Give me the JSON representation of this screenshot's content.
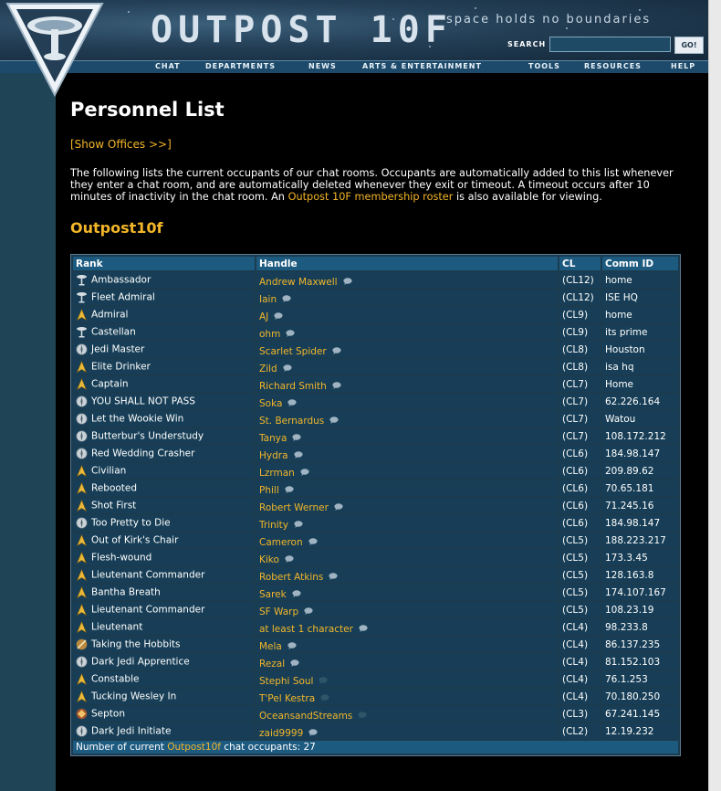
{
  "site": {
    "title": "OUTPOST 10F",
    "tagline": "space holds no boundaries",
    "search_label": "SEARCH",
    "search_value": "",
    "go_label": "GO!"
  },
  "nav": [
    "CHAT",
    "DEPARTMENTS",
    "NEWS",
    "ARTS & ENTERTAINMENT",
    "TOOLS",
    "RESOURCES",
    "HELP"
  ],
  "page": {
    "title": "Personnel List",
    "show_offices": "[Show Offices >>]",
    "intro_1": "The following lists the current occupants of our chat rooms. Occupants are automatically added to this list whenever they enter a chat room, and are automatically deleted whenever they exit or timeout. A timeout occurs after 10 minutes of inactivity in the chat room. An ",
    "intro_link": "Outpost 10F membership roster",
    "intro_2": " is also available for viewing.",
    "room": "Outpost10f"
  },
  "table": {
    "headers": [
      "Rank",
      "Handle",
      "CL",
      "Comm ID"
    ],
    "rows": [
      {
        "icon": "ambassador-icon",
        "rank": "Ambassador",
        "handle": "Andrew Maxwell",
        "cl": "(CL12)",
        "comm": "home"
      },
      {
        "icon": "fleet-admiral-icon",
        "rank": "Fleet Admiral",
        "handle": "Iain",
        "cl": "(CL12)",
        "comm": "ISE HQ"
      },
      {
        "icon": "starfleet-delta-icon",
        "rank": "Admiral",
        "handle": "AJ",
        "cl": "(CL9)",
        "comm": "home"
      },
      {
        "icon": "castellan-icon",
        "rank": "Castellan",
        "handle": "ohm",
        "cl": "(CL9)",
        "comm": "its prime"
      },
      {
        "icon": "jedi-order-icon",
        "rank": "Jedi Master",
        "handle": "Scarlet Spider",
        "cl": "(CL8)",
        "comm": "Houston"
      },
      {
        "icon": "starfleet-delta-icon",
        "rank": "Elite Drinker",
        "handle": "Zild",
        "cl": "(CL8)",
        "comm": "isa hq"
      },
      {
        "icon": "starfleet-delta-icon",
        "rank": "Captain",
        "handle": "Richard Smith",
        "cl": "(CL7)",
        "comm": "Home"
      },
      {
        "icon": "jedi-order-icon",
        "rank": "YOU SHALL NOT PASS",
        "handle": "Soka",
        "cl": "(CL7)",
        "comm": "62.226.164"
      },
      {
        "icon": "jedi-order-icon",
        "rank": "Let the Wookie Win",
        "handle": "St. Bernardus",
        "cl": "(CL7)",
        "comm": "Watou"
      },
      {
        "icon": "jedi-order-icon",
        "rank": "Butterbur's Understudy",
        "handle": "Tanya",
        "cl": "(CL7)",
        "comm": "108.172.212"
      },
      {
        "icon": "jedi-order-icon",
        "rank": "Red Wedding Crasher",
        "handle": "Hydra",
        "cl": "(CL6)",
        "comm": "184.98.147"
      },
      {
        "icon": "starfleet-delta-icon",
        "rank": "Civilian",
        "handle": "Lzrman",
        "cl": "(CL6)",
        "comm": "209.89.62"
      },
      {
        "icon": "starfleet-delta-icon",
        "rank": "Rebooted",
        "handle": "Phill",
        "cl": "(CL6)",
        "comm": "70.65.181"
      },
      {
        "icon": "starfleet-delta-icon",
        "rank": "Shot First",
        "handle": "Robert Werner",
        "cl": "(CL6)",
        "comm": "71.245.16"
      },
      {
        "icon": "jedi-order-icon",
        "rank": "Too Pretty to Die",
        "handle": "Trinity",
        "cl": "(CL6)",
        "comm": "184.98.147"
      },
      {
        "icon": "starfleet-delta-icon",
        "rank": "Out of Kirk's Chair",
        "handle": "Cameron",
        "cl": "(CL5)",
        "comm": "188.223.217"
      },
      {
        "icon": "starfleet-delta-icon",
        "rank": "Flesh-wound",
        "handle": "Kiko",
        "cl": "(CL5)",
        "comm": "173.3.45"
      },
      {
        "icon": "starfleet-delta-icon",
        "rank": "Lieutenant Commander",
        "handle": "Robert Atkins",
        "cl": "(CL5)",
        "comm": "128.163.8"
      },
      {
        "icon": "starfleet-delta-icon",
        "rank": "Bantha Breath",
        "handle": "Sarek",
        "cl": "(CL5)",
        "comm": "174.107.167"
      },
      {
        "icon": "starfleet-delta-icon",
        "rank": "Lieutenant Commander",
        "handle": "SF Warp",
        "cl": "(CL5)",
        "comm": "108.23.19"
      },
      {
        "icon": "starfleet-delta-icon",
        "rank": "Lieutenant",
        "handle": "at least 1 character",
        "cl": "(CL4)",
        "comm": "98.233.8"
      },
      {
        "icon": "hobbit-icon",
        "rank": "Taking the Hobbits",
        "handle": "Mela",
        "cl": "(CL4)",
        "comm": "86.137.235"
      },
      {
        "icon": "jedi-order-icon",
        "rank": "Dark Jedi Apprentice",
        "handle": "Rezal",
        "cl": "(CL4)",
        "comm": "81.152.103"
      },
      {
        "icon": "starfleet-delta-icon",
        "rank": "Constable",
        "handle": "Stephi Soul",
        "cl": "(CL4)",
        "comm": "76.1.253"
      },
      {
        "icon": "starfleet-delta-icon",
        "rank": "Tucking Wesley In",
        "handle": "T'Pel Kestra",
        "cl": "(CL4)",
        "comm": "70.180.250"
      },
      {
        "icon": "septon-icon",
        "rank": "Septon",
        "handle": "OceansandStreams",
        "cl": "(CL3)",
        "comm": "67.241.145"
      },
      {
        "icon": "jedi-order-icon",
        "rank": "Dark Jedi Initiate",
        "handle": "zaid9999",
        "cl": "(CL2)",
        "comm": "12.19.232"
      }
    ],
    "footer_prefix": "Number of current ",
    "footer_link": "Outpost10f",
    "footer_suffix": " chat occupants: 27"
  }
}
